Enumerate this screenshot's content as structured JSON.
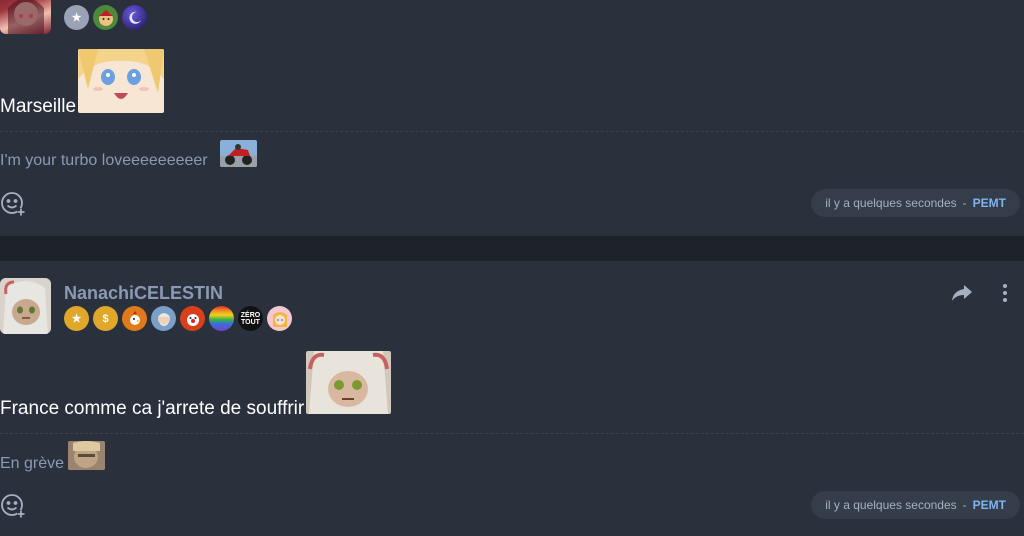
{
  "posts": [
    {
      "username": "",
      "badges": [
        {
          "icon": "star-shield-icon",
          "color": "#9aa3b5"
        },
        {
          "icon": "elf-face-icon",
          "color": "#4a8a3a"
        },
        {
          "icon": "moon-orb-icon",
          "color": "#3b2a8a"
        }
      ],
      "message": "Marseille",
      "quote": "I'm your turbo loveeeeeeeeer",
      "timestamp": "il y a quelques secondes",
      "separator": "-",
      "author": "PEMT"
    },
    {
      "username": "NanachiCELESTIN",
      "badges": [
        {
          "icon": "gold-star-icon",
          "color": "#e0a82a"
        },
        {
          "icon": "dollar-icon",
          "color": "#e0a82a"
        },
        {
          "icon": "chicken-icon",
          "color": "#e07a1a"
        },
        {
          "icon": "old-man-icon",
          "color": "#7aa0c8"
        },
        {
          "icon": "clown-icon",
          "color": "#d8401a"
        },
        {
          "icon": "rainbow-icon",
          "color": "#e04a8a"
        },
        {
          "icon": "zero-tout-icon",
          "color": "#111111",
          "label": "ZÉRO TOUT"
        },
        {
          "icon": "anime-girl-icon",
          "color": "#e88aa0"
        }
      ],
      "message": "France comme ca j'arrete de souffrir",
      "quote": "En grève",
      "timestamp": "il y a quelques secondes",
      "separator": "-",
      "author": "PEMT"
    }
  ]
}
